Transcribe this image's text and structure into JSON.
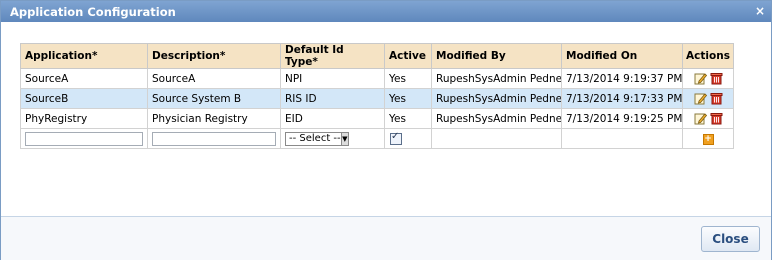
{
  "dialog": {
    "title": "Application Configuration",
    "close_glyph": "×"
  },
  "table": {
    "headers": [
      "Application*",
      "Description*",
      "Default Id Type*",
      "Active",
      "Modified By",
      "Modified On",
      "Actions"
    ],
    "rows": [
      {
        "application": "SourceA",
        "description": "SourceA",
        "id_type": "NPI",
        "active": "Yes",
        "modified_by": "RupeshSysAdmin Pednekar",
        "modified_on": "7/13/2014 9:19:37 PM",
        "selected": false
      },
      {
        "application": "SourceB",
        "description": "Source System B",
        "id_type": "RIS ID",
        "active": "Yes",
        "modified_by": "RupeshSysAdmin Pednekar",
        "modified_on": "7/13/2014 9:17:33 PM",
        "selected": true
      },
      {
        "application": "PhyRegistry",
        "description": "Physician Registry",
        "id_type": "EID",
        "active": "Yes",
        "modified_by": "RupeshSysAdmin Pednekar",
        "modified_on": "7/13/2014 9:19:25 PM",
        "selected": false
      }
    ],
    "new_row": {
      "application_value": "",
      "description_value": "",
      "id_type_selected": "-- Select --",
      "active_checked": true
    },
    "icons": {
      "edit": "edit-icon",
      "delete": "delete-icon",
      "add": "add-icon"
    }
  },
  "footer": {
    "close_label": "Close"
  },
  "colors": {
    "header_bg": "#f5e3c4",
    "selected_row": "#d3e7f8",
    "titlebar": "#6b93c6"
  }
}
